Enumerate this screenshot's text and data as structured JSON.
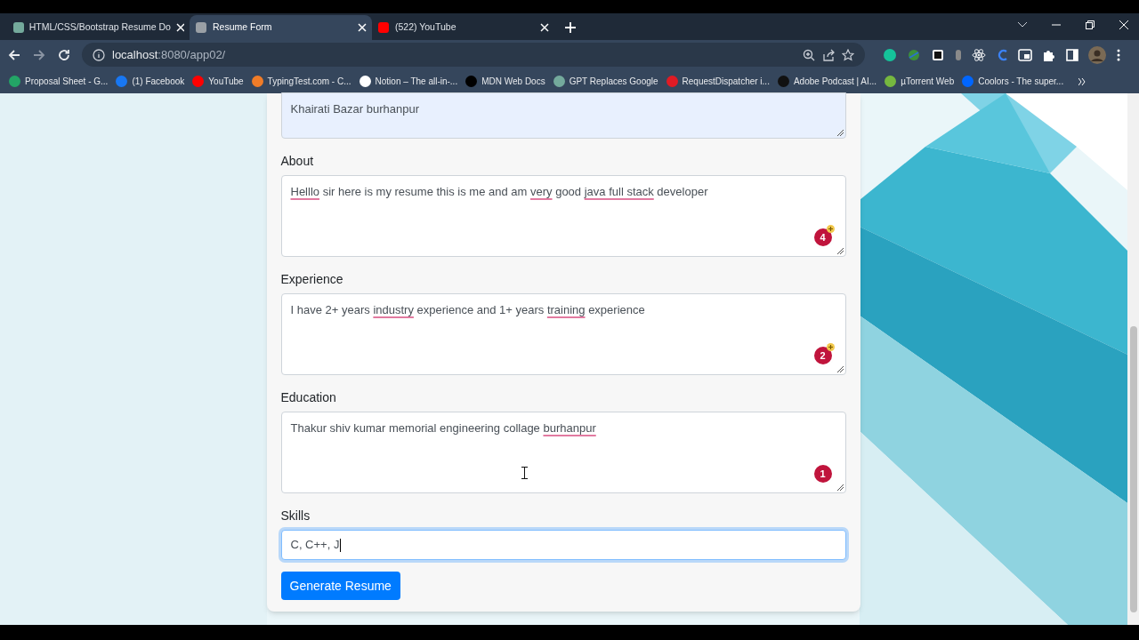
{
  "tabs": [
    {
      "title": "HTML/CSS/Bootstrap Resume Do",
      "selected": false,
      "color": "#74aa9c"
    },
    {
      "title": "Resume Form",
      "selected": true,
      "color": "#9aa0a6"
    },
    {
      "title": "(522) YouTube",
      "selected": false,
      "color": "#ff0000"
    }
  ],
  "address_bar": {
    "host": "localhost",
    "path": ":8080/app02/"
  },
  "bookmarks": [
    {
      "label": "Proposal Sheet - G...",
      "color": "#23a566"
    },
    {
      "label": "(1) Facebook",
      "color": "#1877f2"
    },
    {
      "label": "YouTube",
      "color": "#ff0000"
    },
    {
      "label": "TypingTest.com - C...",
      "color": "#f07c28"
    },
    {
      "label": "Notion – The all-in-...",
      "color": "#ffffff"
    },
    {
      "label": "MDN Web Docs",
      "color": "#000000"
    },
    {
      "label": "GPT Replaces Google",
      "color": "#74aa9c"
    },
    {
      "label": "RequestDispatcher i...",
      "color": "#e01b24"
    },
    {
      "label": "Adobe Podcast | AI...",
      "color": "#111111"
    },
    {
      "label": "µTorrent Web",
      "color": "#76b83f"
    },
    {
      "label": "Coolors - The super...",
      "color": "#0066ff"
    }
  ],
  "form": {
    "fields": [
      {
        "kind": "textarea",
        "value": [
          {
            "text": "Khairati Bazar burhanpur",
            "flagged": false
          }
        ],
        "autofilled": true
      },
      {
        "kind": "textarea",
        "label": "About",
        "value": [
          {
            "text": "Helllo",
            "flagged": true
          },
          {
            "text": " sir here is my resume this is me and am ",
            "flagged": false
          },
          {
            "text": "very",
            "flagged": true
          },
          {
            "text": " good ",
            "flagged": false
          },
          {
            "text": "java full stack",
            "flagged": true
          },
          {
            "text": " developer",
            "flagged": false
          }
        ],
        "autofilled": false,
        "grammar_count": "4",
        "grammar_plus": true
      },
      {
        "kind": "textarea",
        "label": "Experience",
        "value": [
          {
            "text": "I have 2+ years ",
            "flagged": false
          },
          {
            "text": "industry",
            "flagged": true
          },
          {
            "text": " experience and 1+ years ",
            "flagged": false
          },
          {
            "text": "training",
            "flagged": true
          },
          {
            "text": " experience",
            "flagged": false
          }
        ],
        "autofilled": false,
        "grammar_count": "2",
        "grammar_plus": true
      },
      {
        "kind": "textarea",
        "label": "Education",
        "value": [
          {
            "text": "Thakur shiv kumar memorial engineering collage ",
            "flagged": false
          },
          {
            "text": "burhanpur",
            "flagged": true
          }
        ],
        "autofilled": false,
        "grammar_count": "1",
        "grammar_plus": false
      },
      {
        "kind": "input",
        "label": "Skills",
        "value": [
          {
            "text": "C, C++, J",
            "flagged": false
          }
        ],
        "focused": true
      }
    ],
    "submit": "Generate Resume"
  }
}
